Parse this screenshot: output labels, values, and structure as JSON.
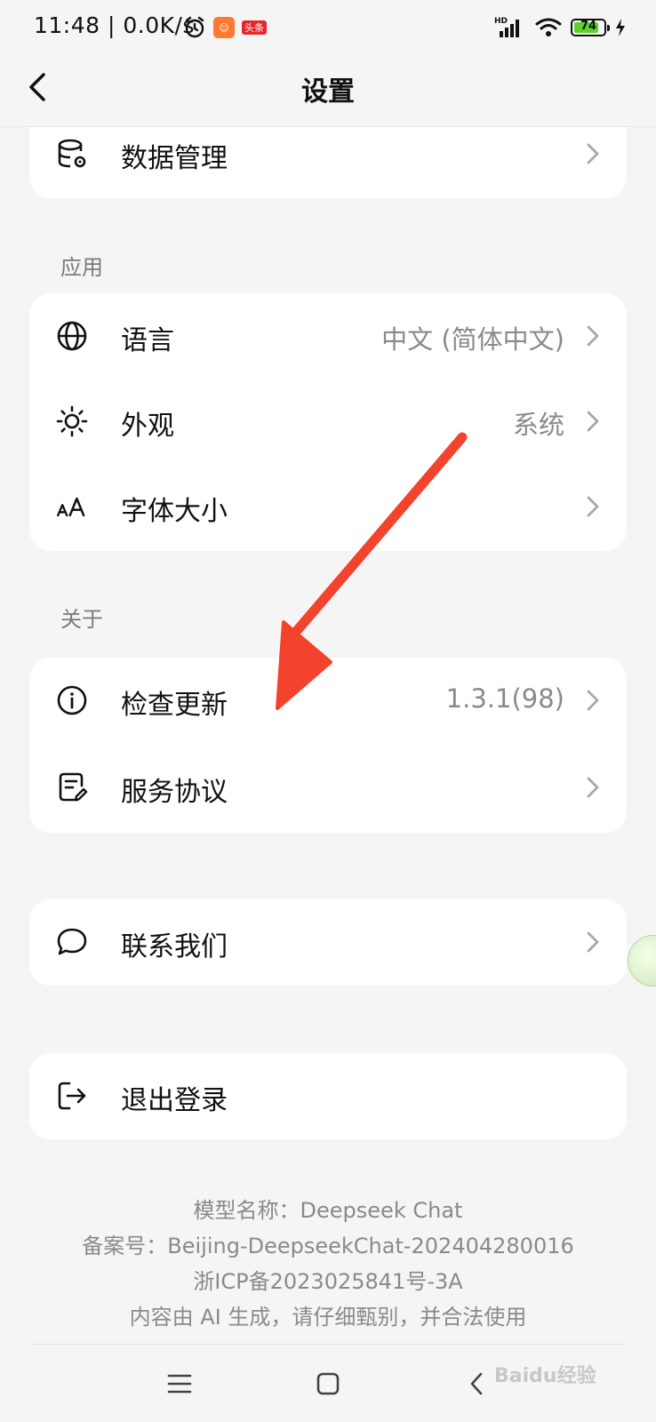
{
  "status_bar": {
    "time": "11:48",
    "net_speed": "| 0.0K/s",
    "app_badge_2": "头条",
    "network": "HD",
    "battery_percent": "74"
  },
  "header": {
    "title": "设置"
  },
  "data_card": {
    "label": "数据管理"
  },
  "apps_section": {
    "title": "应用",
    "items": [
      {
        "label": "语言",
        "value": "中文 (简体中文)"
      },
      {
        "label": "外观",
        "value": "系统"
      },
      {
        "label": "字体大小",
        "value": ""
      }
    ]
  },
  "about_section": {
    "title": "关于",
    "items": [
      {
        "label": "检查更新",
        "value": "1.3.1(98)"
      },
      {
        "label": "服务协议",
        "value": ""
      }
    ]
  },
  "contact": {
    "label": "联系我们"
  },
  "logout": {
    "label": "退出登录"
  },
  "footer": {
    "model_name": "模型名称：Deepseek Chat",
    "filing_no": "备案号：Beijing-DeepseekChat-202404280016",
    "icp": "浙ICP备2023025841号-3A",
    "disclaimer": "内容由 AI 生成，请仔细甄别，并合法使用"
  },
  "watermark": "Baidu经验",
  "colors": {
    "background": "#f5f5f5",
    "card": "#ffffff",
    "arrow": "#f4432c",
    "battery": "#5dd32a"
  }
}
